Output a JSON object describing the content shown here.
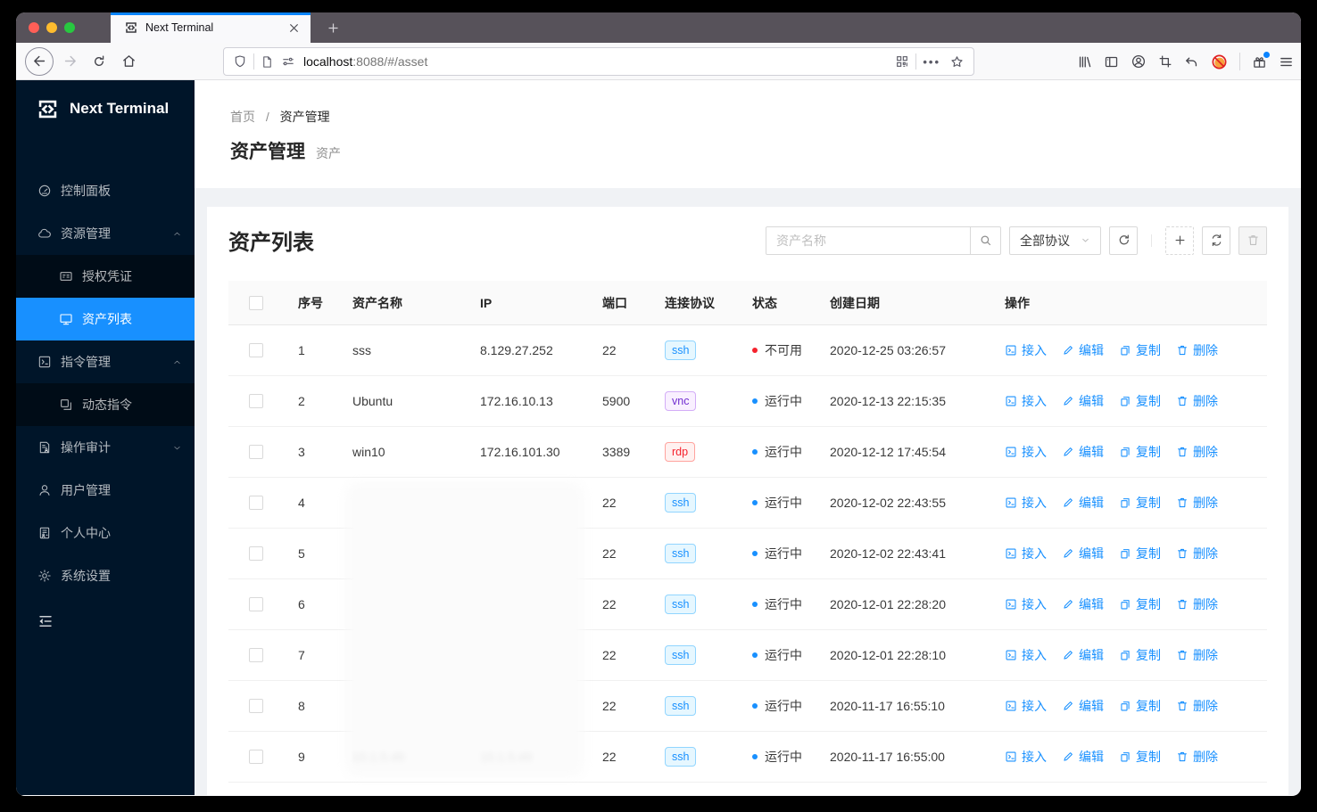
{
  "browser": {
    "tab": {
      "title": "Next Terminal"
    },
    "address": {
      "host": "localhost",
      "path": ":8088/#/asset"
    }
  },
  "sidebar": {
    "logo_text": "Next Terminal",
    "items": [
      {
        "id": "dashboard",
        "label": "控制面板",
        "icon": "dashboard-icon",
        "type": "item"
      },
      {
        "id": "resource",
        "label": "资源管理",
        "icon": "cloud-icon",
        "type": "group",
        "arrow": "up"
      },
      {
        "id": "credential",
        "label": "授权凭证",
        "icon": "idcard-icon",
        "type": "subitem"
      },
      {
        "id": "asset-list",
        "label": "资产列表",
        "icon": "desktop-icon",
        "type": "subitem",
        "active": true
      },
      {
        "id": "command",
        "label": "指令管理",
        "icon": "code-icon",
        "type": "group",
        "arrow": "up"
      },
      {
        "id": "dynamic-command",
        "label": "动态指令",
        "icon": "block-icon",
        "type": "subitem"
      },
      {
        "id": "audit",
        "label": "操作审计",
        "icon": "audit-icon",
        "type": "group",
        "arrow": "down"
      },
      {
        "id": "user",
        "label": "用户管理",
        "icon": "user-icon",
        "type": "item"
      },
      {
        "id": "profile",
        "label": "个人中心",
        "icon": "solution-icon",
        "type": "item"
      },
      {
        "id": "setting",
        "label": "系统设置",
        "icon": "setting-icon",
        "type": "item"
      }
    ],
    "collapse_icon": "menu-fold-icon"
  },
  "breadcrumb": {
    "items": [
      "首页",
      "资产管理"
    ],
    "separator": "/"
  },
  "page_header": {
    "title": "资产管理",
    "subtitle": "资产"
  },
  "asset_card": {
    "title": "资产列表",
    "search": {
      "placeholder": "资产名称"
    },
    "protocol_select": {
      "value": "全部协议"
    }
  },
  "table": {
    "columns": {
      "index": "序号",
      "name": "资产名称",
      "ip": "IP",
      "port": "端口",
      "protocol": "连接协议",
      "status": "状态",
      "created": "创建日期",
      "actions": "操作"
    },
    "action_labels": {
      "connect": "接入",
      "edit": "编辑",
      "copy": "复制",
      "delete": "删除"
    },
    "rows": [
      {
        "index": "1",
        "name": "sss",
        "ip": "8.129.27.252",
        "port": "22",
        "protocol": "ssh",
        "status": "不可用",
        "status_type": "error",
        "created": "2020-12-25 03:26:57",
        "redacted": false
      },
      {
        "index": "2",
        "name": "Ubuntu",
        "ip": "172.16.10.13",
        "port": "5900",
        "protocol": "vnc",
        "status": "运行中",
        "status_type": "running",
        "created": "2020-12-13 22:15:35",
        "redacted": false
      },
      {
        "index": "3",
        "name": "win10",
        "ip": "172.16.101.30",
        "port": "3389",
        "protocol": "rdp",
        "status": "运行中",
        "status_type": "running",
        "created": "2020-12-12 17:45:54",
        "redacted": false
      },
      {
        "index": "4",
        "name": "",
        "ip": "",
        "port": "22",
        "protocol": "ssh",
        "status": "运行中",
        "status_type": "running",
        "created": "2020-12-02 22:43:55",
        "redacted": true
      },
      {
        "index": "5",
        "name": "",
        "ip": "",
        "port": "22",
        "protocol": "ssh",
        "status": "运行中",
        "status_type": "running",
        "created": "2020-12-02 22:43:41",
        "redacted": true
      },
      {
        "index": "6",
        "name": "",
        "ip": "",
        "port": "22",
        "protocol": "ssh",
        "status": "运行中",
        "status_type": "running",
        "created": "2020-12-01 22:28:20",
        "redacted": true
      },
      {
        "index": "7",
        "name": "",
        "ip": "",
        "port": "22",
        "protocol": "ssh",
        "status": "运行中",
        "status_type": "running",
        "created": "2020-12-01 22:28:10",
        "redacted": true
      },
      {
        "index": "8",
        "name": "",
        "ip": "",
        "port": "22",
        "protocol": "ssh",
        "status": "运行中",
        "status_type": "running",
        "created": "2020-11-17 16:55:10",
        "redacted": true
      },
      {
        "index": "9",
        "name": "10.1.5.49",
        "ip": "10.1.5.49",
        "port": "22",
        "protocol": "ssh",
        "status": "运行中",
        "status_type": "running",
        "created": "2020-11-17 16:55:00",
        "redacted": true
      }
    ]
  },
  "colors": {
    "accent": "#1890ff",
    "sidebar_bg": "#001529",
    "submenu_bg": "#000c17",
    "active_item_bg": "#1890ff",
    "status_running": "#1890ff",
    "status_error": "#f5222d",
    "tag_ssh": {
      "bg": "#e6f7ff",
      "border": "#91d5ff",
      "text": "#1890ff"
    },
    "tag_vnc": {
      "bg": "#f9f0ff",
      "border": "#d3adf7",
      "text": "#722ed1"
    },
    "tag_rdp": {
      "bg": "#fff1f0",
      "border": "#ffa39e",
      "text": "#f5222d"
    }
  }
}
